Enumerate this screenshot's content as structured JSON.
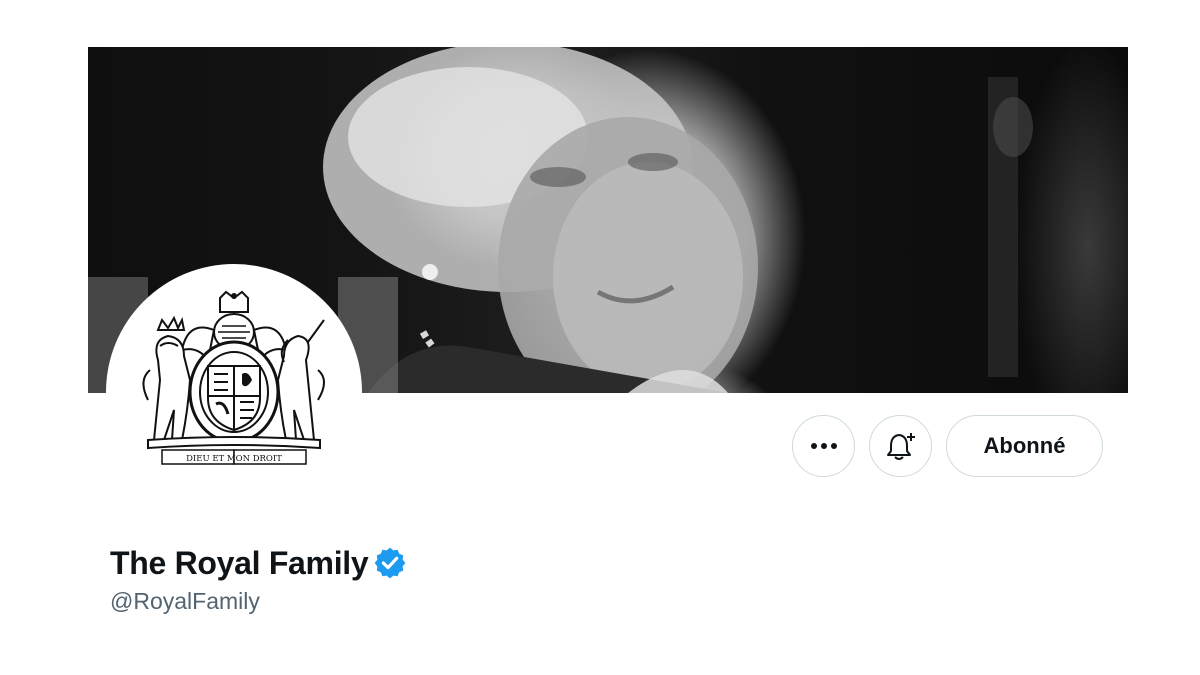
{
  "profile": {
    "display_name": "The Royal Family",
    "handle": "@RoyalFamily",
    "verified": true,
    "avatar_icon": "royal-coat-of-arms-icon",
    "avatar_motto": "DIEU ET MON DROIT",
    "banner_image": "black-and-white portrait photograph"
  },
  "actions": {
    "more_icon": "more-dots-icon",
    "notify_icon": "bell-plus-icon",
    "follow_label": "Abonné"
  },
  "colors": {
    "text_primary": "#0f1419",
    "text_secondary": "#536471",
    "verified_blue": "#1d9bf0",
    "button_border": "#cfd9de"
  }
}
